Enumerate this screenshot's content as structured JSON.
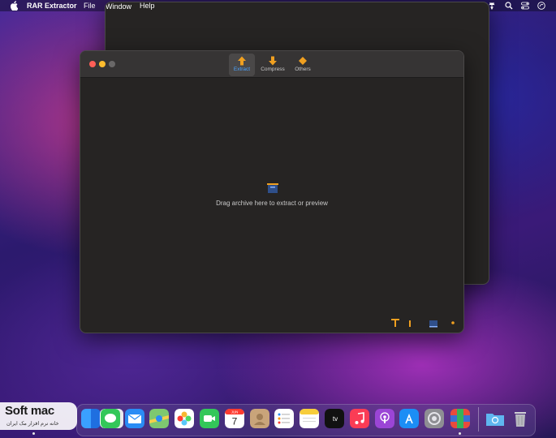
{
  "menubar": {
    "app_name": "RAR Extractor",
    "menus": [
      "File",
      "Window",
      "Help"
    ],
    "status_icons": [
      "wifi-icon",
      "search-icon",
      "control-center-icon",
      "siri-icon"
    ]
  },
  "toolbar": {
    "items": [
      {
        "label": "Extract",
        "icon": "extract-arrow-icon",
        "active": true
      },
      {
        "label": "Compress",
        "icon": "compress-arrow-icon",
        "active": false
      },
      {
        "label": "Others",
        "icon": "others-diamond-icon",
        "active": false
      }
    ]
  },
  "main": {
    "drop_text": "Drag archive here to extract or preview"
  },
  "statusbar_icons": [
    "tool-icon",
    "progress-icon",
    "archive-icon",
    "settings-dot-icon"
  ],
  "dock": {
    "apps": [
      "finder",
      "launchpad",
      "safari",
      "messages",
      "mail",
      "maps",
      "photos",
      "facetime",
      "calendar",
      "contacts",
      "reminders",
      "notes",
      "tv",
      "music",
      "podcasts",
      "app-store",
      "system-preferences",
      "rar-extractor",
      "downloads-folder",
      "trash"
    ],
    "calendar": {
      "month": "JUN",
      "day": "7"
    },
    "tv_label": "tv"
  },
  "watermark": {
    "title": "Soft mac",
    "subtitle": "خانه نرم افزار مک ایران"
  },
  "colors": {
    "accent": "#4aa3ff",
    "toolbar_icon": "#f0a020",
    "window_bg": "#262423",
    "titlebar_bg": "#363434"
  }
}
